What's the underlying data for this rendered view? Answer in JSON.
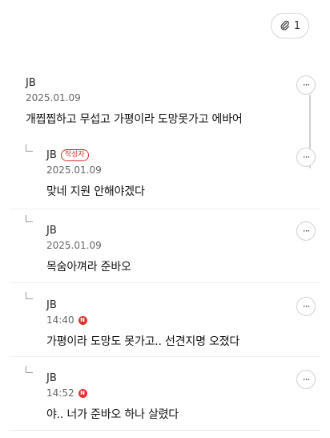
{
  "attachment": {
    "count": "1",
    "icon": "paperclip-icon"
  },
  "more_label": "···",
  "comments": [
    {
      "name": "JB",
      "date": "2025.01.09",
      "text": "개찝찝하고 무섭고 가평이라 도망못가고 에바어"
    },
    {
      "name": "JB",
      "badge": "작성자",
      "date": "2025.01.09",
      "text": "맞네 지원 안해야겠다"
    },
    {
      "name": "JB",
      "date": "2025.01.09",
      "text": "목숨아껴라 준바오"
    },
    {
      "name": "JB",
      "date": "14:40",
      "new": "N",
      "text": "가평이라 도망도 못가고.. 선견지명 오졌다"
    },
    {
      "name": "JB",
      "date": "14:52",
      "new": "N",
      "text": "야.. 너가 준바오 하나 살렸다"
    }
  ],
  "colors": {
    "accent_red": "#e0322c",
    "border": "#d6d6d6"
  }
}
